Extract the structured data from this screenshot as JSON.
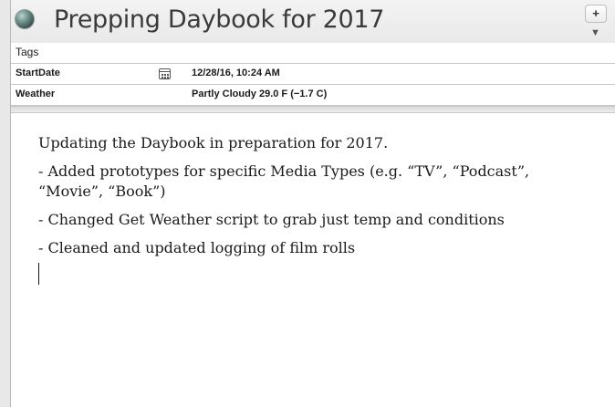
{
  "note": {
    "title": "Prepping Daybook for 2017",
    "add_button_label": "+",
    "collapse_label": "▼"
  },
  "properties": {
    "tags": {
      "label": "Tags",
      "value": ""
    },
    "start_date": {
      "label": "StartDate",
      "value": "12/28/16, 10:24 AM",
      "icon": "calendar-icon"
    },
    "weather": {
      "label": "Weather",
      "value": "Partly Cloudy  29.0 F (−1.7 C)"
    }
  },
  "body": {
    "lines": [
      "Updating the Daybook in preparation for 2017.",
      "- Added prototypes for specific Media Types (e.g. “TV”, “Podcast”, “Movie”, “Book”)",
      "- Changed Get Weather script to grab just temp and conditions",
      "- Cleaned and updated logging of film rolls"
    ]
  }
}
